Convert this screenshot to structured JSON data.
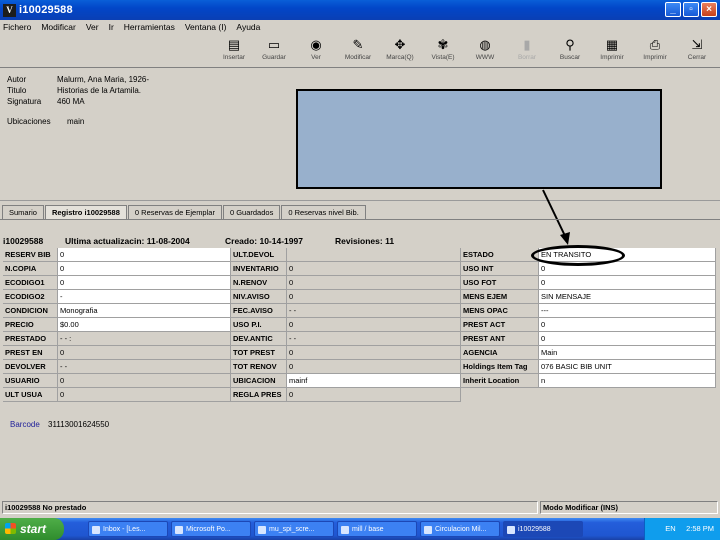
{
  "window": {
    "title": "i10029588",
    "app_icon": "V"
  },
  "menu": [
    "Fichero",
    "Modificar",
    "Ver",
    "Ir",
    "Herramientas",
    "Ventana (I)",
    "Ayuda"
  ],
  "toolbar": [
    {
      "name": "insertar",
      "label": "Insertar",
      "icon": "▤"
    },
    {
      "name": "guardar",
      "label": "Guardar",
      "icon": "▭"
    },
    {
      "name": "ver",
      "label": "Ver",
      "icon": "◉"
    },
    {
      "name": "modificar",
      "label": "Modificar",
      "icon": "✎"
    },
    {
      "name": "marca",
      "label": "Marca(Q)",
      "icon": "✥"
    },
    {
      "name": "vista",
      "label": "Vista(E)",
      "icon": "✾"
    },
    {
      "name": "web",
      "label": "WWW",
      "icon": "◍"
    },
    {
      "name": "borrar",
      "label": "Borrar",
      "icon": "▮",
      "disabled": true
    },
    {
      "name": "buscar",
      "label": "Buscar",
      "icon": "⚲"
    },
    {
      "name": "imprimir-pantalla",
      "label": "Imprimir",
      "icon": "▦"
    },
    {
      "name": "imprimir",
      "label": "Imprimir",
      "icon": "⎙"
    },
    {
      "name": "cerrar",
      "label": "Cerrar",
      "icon": "⇲"
    }
  ],
  "header": {
    "autor_key": "Autor",
    "autor": "Malurm, Ana Maria, 1926-",
    "titulo_key": "Titulo",
    "titulo": "Historias de la Artamila.",
    "signatura_key": "Signatura",
    "signatura": "460 MA",
    "ubicaciones_key": "Ubicaciones",
    "ubicaciones": "main"
  },
  "tabs": [
    "Sumario",
    "Registro i10029588",
    "0 Reservas de Ejemplar",
    "0 Guardados",
    "0 Reservas nivel Bib."
  ],
  "record": {
    "id": "i10029588",
    "updated": "Ultima actualizacin: 11-08-2004",
    "created": "Creado: 10-14-1997",
    "revisions": "Revisiones: 11"
  },
  "grid": {
    "col1": [
      {
        "k": "RESERV BIB",
        "v": "0",
        "w": true
      },
      {
        "k": "N.COPIA",
        "v": "0",
        "w": true
      },
      {
        "k": "ECODIGO1",
        "v": "0",
        "w": true
      },
      {
        "k": "ECODIGO2",
        "v": "-",
        "w": true
      },
      {
        "k": "CONDICION",
        "v": "Monografia",
        "w": true
      },
      {
        "k": "PRECIO",
        "v": "$0.00",
        "w": true
      },
      {
        "k": "PRESTADO",
        "v": "- -   :",
        "w": false
      },
      {
        "k": "PREST EN",
        "v": "0",
        "w": false
      },
      {
        "k": "DEVOLVER",
        "v": "- -",
        "w": false
      },
      {
        "k": "USUARIO",
        "v": "0",
        "w": false
      },
      {
        "k": "ULT USUA",
        "v": "0",
        "w": false
      }
    ],
    "col2": [
      {
        "k": "ULT.DEVOL",
        "v": ""
      },
      {
        "k": "INVENTARIO",
        "v": "0"
      },
      {
        "k": "N.RENOV",
        "v": "0"
      },
      {
        "k": "NIV.AVISO",
        "v": "0"
      },
      {
        "k": "FEC.AVISO",
        "v": "- -"
      },
      {
        "k": "USO P.I.",
        "v": "0"
      },
      {
        "k": "DEV.ANTIC",
        "v": "- -"
      },
      {
        "k": "TOT PREST",
        "v": "0"
      },
      {
        "k": "TOT RENOV",
        "v": "0"
      },
      {
        "k": "UBICACION",
        "v": "mainf",
        "w": true
      },
      {
        "k": "REGLA PRES",
        "v": "0"
      }
    ],
    "col3": [
      {
        "k": "ESTADO",
        "v": "EN TRANSITO",
        "w": true
      },
      {
        "k": "USO INT",
        "v": "0",
        "w": true
      },
      {
        "k": "USO FOT",
        "v": "0",
        "w": true
      },
      {
        "k": "MENS EJEM",
        "v": "SIN MENSAJE",
        "w": true
      },
      {
        "k": "MENS OPAC",
        "v": "---",
        "w": true
      },
      {
        "k": "PREST ACT",
        "v": "0",
        "w": true
      },
      {
        "k": "PREST ANT",
        "v": "0",
        "w": true
      },
      {
        "k": "AGENCIA",
        "v": "Main",
        "w": true
      },
      {
        "k": "Holdings Item Tag",
        "v": "076 BASIC BIB UNIT",
        "w": true
      },
      {
        "k": "Inherit Location",
        "v": "n",
        "w": true
      }
    ]
  },
  "barcode": {
    "key": "Barcode",
    "value": "31113001624550"
  },
  "statusbar": {
    "left": "i10029588 No prestado",
    "right": "Modo Modificar (INS)"
  },
  "taskbar": {
    "start": "start",
    "tasks": [
      {
        "label": "Inbox - [Les...",
        "active": false
      },
      {
        "label": "Microsoft Po...",
        "active": false
      },
      {
        "label": "mu_spi_scre...",
        "active": false
      },
      {
        "label": "mill / base",
        "active": false
      },
      {
        "label": "Circulacion Mil...",
        "active": false
      },
      {
        "label": "i10029588",
        "active": true
      }
    ],
    "tray": {
      "lang": "EN",
      "time": "2:58 PM"
    }
  }
}
